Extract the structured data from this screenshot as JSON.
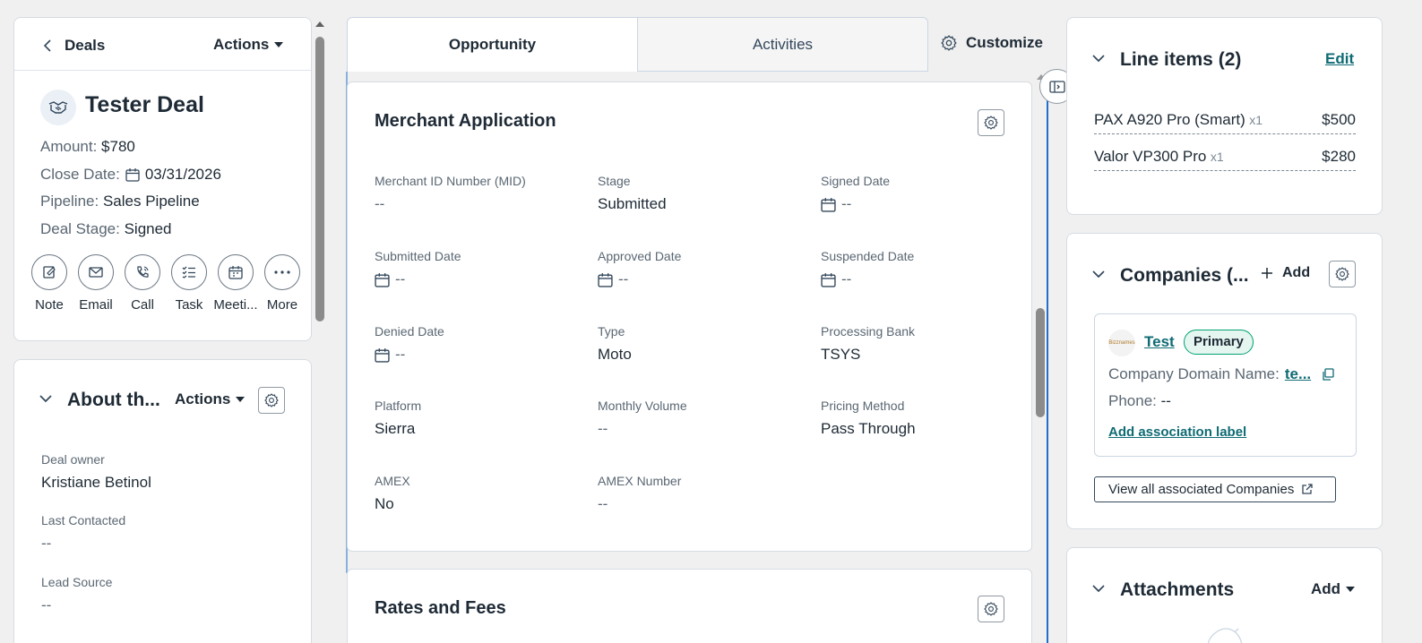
{
  "left": {
    "back_label": "Deals",
    "actions_label": "Actions",
    "record_title": "Tester Deal",
    "props": [
      {
        "label": "Amount:",
        "value": "$780"
      },
      {
        "label": "Close Date:",
        "value": "03/31/2026"
      },
      {
        "label": "Pipeline:",
        "value": "Sales Pipeline"
      },
      {
        "label": "Deal Stage:",
        "value": "Signed"
      }
    ],
    "quick_actions": [
      "Note",
      "Email",
      "Call",
      "Task",
      "Meeti...",
      "More"
    ],
    "about": {
      "title": "About th...",
      "actions_label": "Actions",
      "fields": [
        {
          "label": "Deal owner",
          "value": "Kristiane Betinol"
        },
        {
          "label": "Last Contacted",
          "value": "--"
        },
        {
          "label": "Lead Source",
          "value": "--"
        }
      ]
    }
  },
  "tabs": {
    "opportunity": "Opportunity",
    "activities": "Activities",
    "customize": "Customize"
  },
  "merchant": {
    "title": "Merchant Application",
    "fields": [
      {
        "label": "Merchant ID Number (MID)",
        "value": "--",
        "date": false
      },
      {
        "label": "Stage",
        "value": "Submitted",
        "date": false
      },
      {
        "label": "Signed Date",
        "value": "--",
        "date": true
      },
      {
        "label": "Submitted Date",
        "value": "--",
        "date": true
      },
      {
        "label": "Approved Date",
        "value": "--",
        "date": true
      },
      {
        "label": "Suspended Date",
        "value": "--",
        "date": true
      },
      {
        "label": "Denied Date",
        "value": "--",
        "date": true
      },
      {
        "label": "Type",
        "value": "Moto",
        "date": false
      },
      {
        "label": "Processing Bank",
        "value": "TSYS",
        "date": false
      },
      {
        "label": "Platform",
        "value": "Sierra",
        "date": false
      },
      {
        "label": "Monthly Volume",
        "value": "--",
        "date": false
      },
      {
        "label": "Pricing Method",
        "value": "Pass Through",
        "date": false
      },
      {
        "label": "AMEX",
        "value": "No",
        "date": false
      },
      {
        "label": "AMEX Number",
        "value": "--",
        "date": false
      }
    ]
  },
  "rates": {
    "title": "Rates and Fees"
  },
  "right": {
    "line_items": {
      "title": "Line items (2)",
      "edit_label": "Edit",
      "items": [
        {
          "name": "PAX A920 Pro (Smart)",
          "qty": "x1",
          "price": "$500"
        },
        {
          "name": "Valor VP300 Pro",
          "qty": "x1",
          "price": "$280"
        }
      ]
    },
    "companies": {
      "title": "Companies (...",
      "add_label": "Add",
      "company_name": "Test",
      "badge": "Primary",
      "logo_text": "Bizznames",
      "domain_label": "Company Domain Name:",
      "domain_value": "te...",
      "phone_label": "Phone:",
      "phone_value": "--",
      "assoc_label": "Add association label",
      "view_all": "View all associated Companies"
    },
    "attachments": {
      "title": "Attachments",
      "add_label": "Add"
    }
  },
  "colors": {
    "link": "#0f6b74",
    "badge_border": "#00a371",
    "badge_bg": "#e5f5f0",
    "active_rail": "#1f6fcc"
  }
}
